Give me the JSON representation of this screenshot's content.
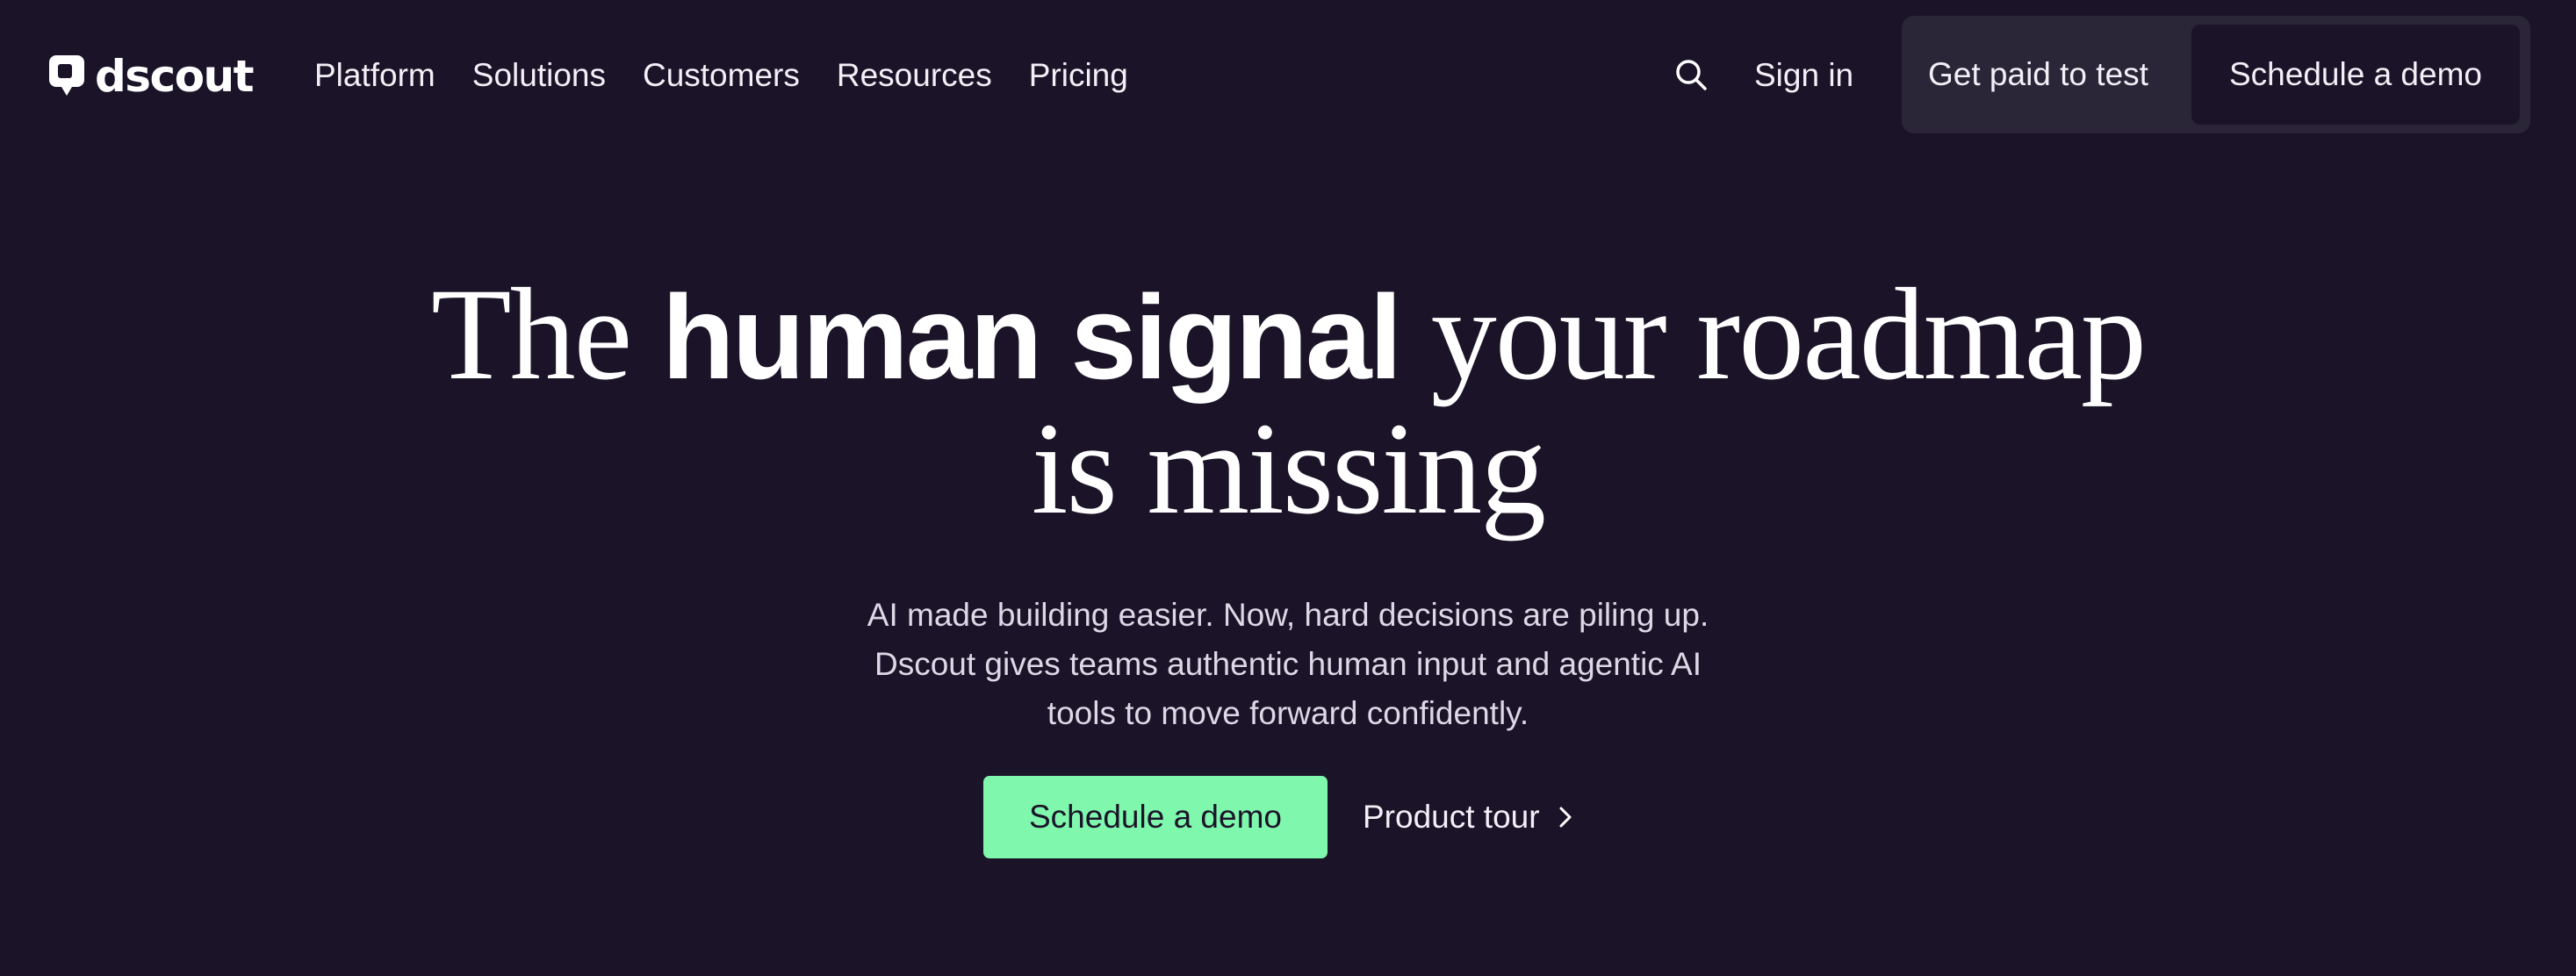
{
  "brand": {
    "name": "dscout",
    "logo_icon": "speech-bubble-icon"
  },
  "nav": {
    "items": [
      {
        "label": "Platform"
      },
      {
        "label": "Solutions"
      },
      {
        "label": "Customers"
      },
      {
        "label": "Resources"
      },
      {
        "label": "Pricing"
      }
    ],
    "search_icon": "search-icon",
    "signin_label": "Sign in",
    "getpaid_label": "Get paid to test",
    "demo_label": "Schedule a demo"
  },
  "hero": {
    "title_pre": "The ",
    "title_emphasis": "human signal",
    "title_post": " your roadmap",
    "title_line2": "is missing",
    "subtitle_lines": [
      "AI made building easier. Now, hard decisions are piling up.",
      "Dscout gives teams authentic human input and agentic AI",
      "tools to move forward confidently."
    ],
    "primary_cta": "Schedule a demo",
    "secondary_cta": "Product tour",
    "secondary_icon": "chevron-right-icon"
  },
  "colors": {
    "background": "#1b1428",
    "accent_green": "#7ff7ad",
    "nav_cta_group": "#2b2538",
    "text": "#ffffff"
  }
}
